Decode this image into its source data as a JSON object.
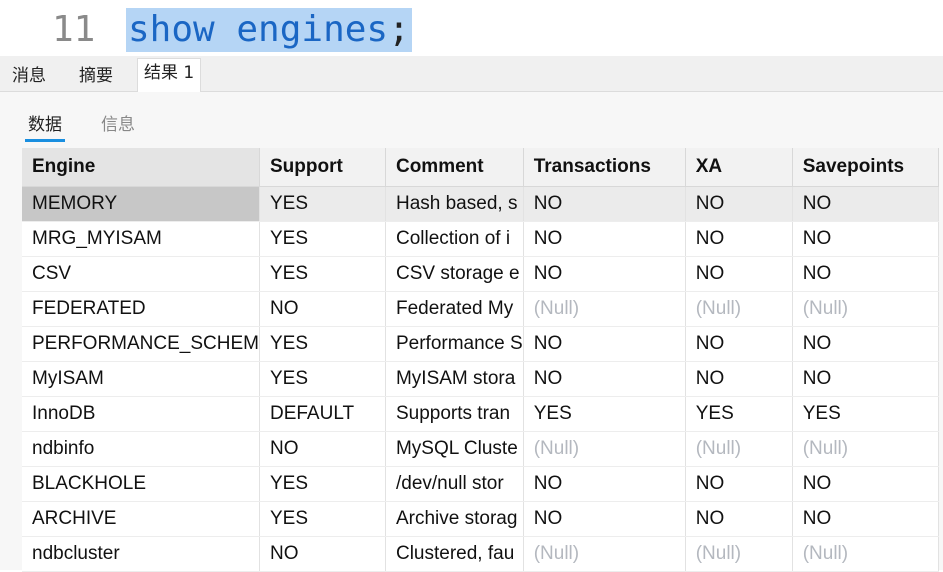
{
  "editor": {
    "line_number": "11",
    "code": "show engines",
    "semicolon": ";"
  },
  "tabs": [
    {
      "label": "消息"
    },
    {
      "label": "摘要"
    },
    {
      "label": "结果 1"
    }
  ],
  "subtabs": [
    {
      "label": "数据"
    },
    {
      "label": "信息"
    }
  ],
  "table": {
    "headers": [
      "Engine",
      "Support",
      "Comment",
      "Transactions",
      "XA",
      "Savepoints"
    ],
    "rows": [
      [
        "MEMORY",
        "YES",
        "Hash based, s",
        "NO",
        "NO",
        "NO"
      ],
      [
        "MRG_MYISAM",
        "YES",
        "Collection of i",
        "NO",
        "NO",
        "NO"
      ],
      [
        "CSV",
        "YES",
        "CSV storage e",
        "NO",
        "NO",
        "NO"
      ],
      [
        "FEDERATED",
        "NO",
        "Federated My",
        "(Null)",
        "(Null)",
        "(Null)"
      ],
      [
        "PERFORMANCE_SCHEM",
        "YES",
        "Performance S",
        "NO",
        "NO",
        "NO"
      ],
      [
        "MyISAM",
        "YES",
        "MyISAM stora",
        "NO",
        "NO",
        "NO"
      ],
      [
        "InnoDB",
        "DEFAULT",
        "Supports tran",
        "YES",
        "YES",
        "YES"
      ],
      [
        "ndbinfo",
        "NO",
        "MySQL Cluste",
        "(Null)",
        "(Null)",
        "(Null)"
      ],
      [
        "BLACKHOLE",
        "YES",
        "/dev/null stor",
        "NO",
        "NO",
        "NO"
      ],
      [
        "ARCHIVE",
        "YES",
        "Archive storag",
        "NO",
        "NO",
        "NO"
      ],
      [
        "ndbcluster",
        "NO",
        "Clustered, fau",
        "(Null)",
        "(Null)",
        "(Null)"
      ]
    ]
  },
  "colors": {
    "selection_highlight": "#b5d5f5",
    "keyword_blue": "#1a66c4",
    "active_underline": "#1a8fe0",
    "null_text": "#b4b8bf"
  }
}
